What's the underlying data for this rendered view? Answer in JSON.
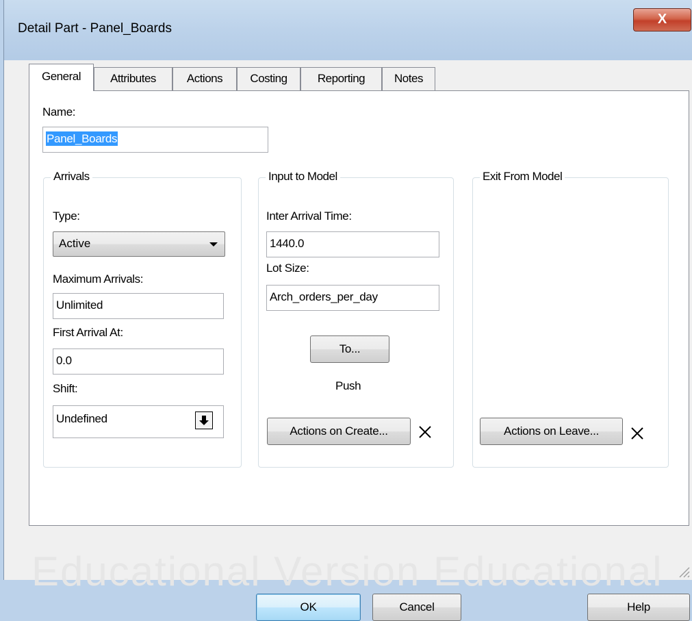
{
  "window": {
    "title": "Detail Part - Panel_Boards",
    "close_label": "X"
  },
  "tabs": [
    {
      "label": "General",
      "active": true
    },
    {
      "label": "Attributes",
      "active": false
    },
    {
      "label": "Actions",
      "active": false
    },
    {
      "label": "Costing",
      "active": false
    },
    {
      "label": "Reporting",
      "active": false
    },
    {
      "label": "Notes",
      "active": false
    }
  ],
  "general": {
    "name_label": "Name:",
    "name_value": "Panel_Boards",
    "arrivals": {
      "title": "Arrivals",
      "type_label": "Type:",
      "type_value": "Active",
      "max_label": "Maximum Arrivals:",
      "max_value": "Unlimited",
      "first_label": "First Arrival At:",
      "first_value": "0.0",
      "shift_label": "Shift:",
      "shift_value": "Undefined"
    },
    "input_model": {
      "title": "Input to Model",
      "iat_label": "Inter Arrival Time:",
      "iat_value": "1440.0",
      "lot_label": "Lot Size:",
      "lot_value": "Arch_orders_per_day",
      "to_button": "To...",
      "routing_text": "Push",
      "actions_button": "Actions on Create..."
    },
    "exit_model": {
      "title": "Exit From Model",
      "actions_button": "Actions on Leave..."
    }
  },
  "footer": {
    "ok": "OK",
    "cancel": "Cancel",
    "help": "Help"
  },
  "watermark": "Educational Version Educational"
}
